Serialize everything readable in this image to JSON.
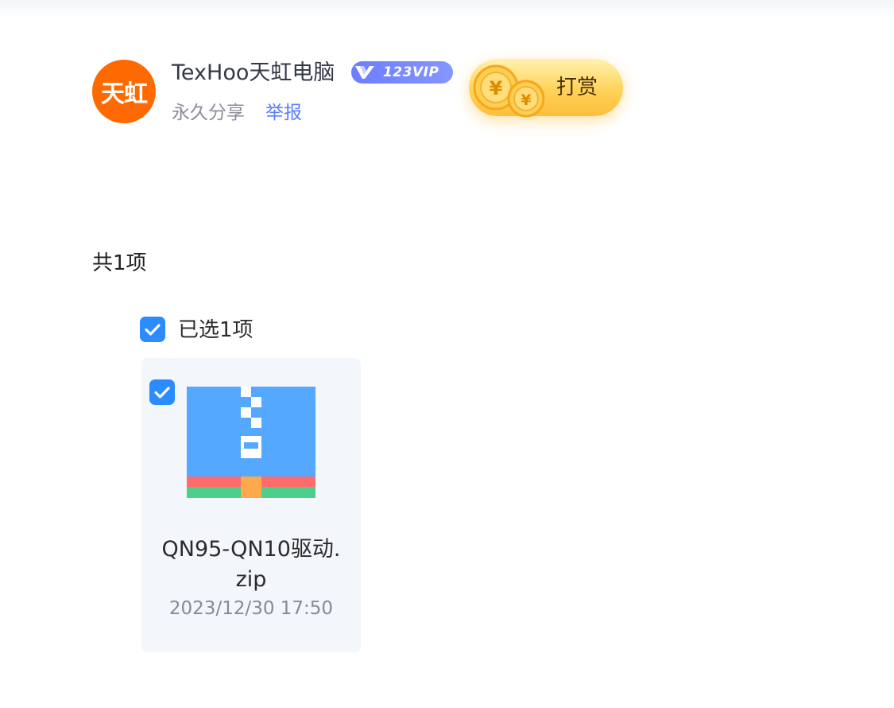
{
  "header": {
    "avatar_text": "天虹",
    "username": "TexHoo天虹电脑",
    "vip_badge": "123VIP",
    "share_type": "永久分享",
    "report_label": "举报",
    "tip_label": "打赏"
  },
  "list": {
    "item_count": "共1项",
    "select_all_label": "已选1项"
  },
  "files": [
    {
      "name_line1": "QN95-QN10驱动.",
      "name_line2": "zip",
      "date": "2023/12/30 17:50",
      "icon": "zip-archive-icon",
      "selected": true
    }
  ],
  "colors": {
    "accent": "#2a8cff",
    "avatar_bg": "#ff6a00",
    "link": "#5b7cff",
    "card_bg": "#f3f6fa"
  }
}
